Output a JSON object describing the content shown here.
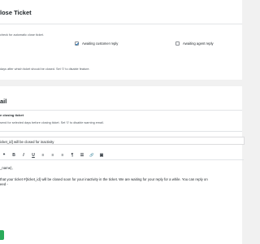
{
  "auto_close": {
    "title": "lose Ticket",
    "desc1": "check for automatic close ticket.",
    "options": [
      {
        "label": "Awaiting customer reply",
        "checked": true
      },
      {
        "label": "Awaiting agent reply",
        "checked": false
      }
    ],
    "desc2": "days after which ticket should be closed. Set '0' to disable feature."
  },
  "warning_email": {
    "title": "ail",
    "label": "e closing ticket",
    "desc": "send for selected days before closing ticket. Set '0' to disable warning email.",
    "subject_value": "icket_id] will be closed for inactivity",
    "toolbar": [
      {
        "name": "quote-icon",
        "glyph": "❝"
      },
      {
        "name": "bold-icon",
        "glyph": "B"
      },
      {
        "name": "italic-icon",
        "glyph": "I"
      },
      {
        "name": "underline-icon",
        "glyph": "U"
      },
      {
        "name": "align-left-icon",
        "glyph": "≡"
      },
      {
        "name": "align-center-icon",
        "glyph": "≡"
      },
      {
        "name": "align-right-icon",
        "glyph": "≡"
      },
      {
        "name": "paragraph-icon",
        "glyph": "¶"
      },
      {
        "name": "list-icon",
        "glyph": "☰"
      },
      {
        "name": "link-icon",
        "glyph": "🔗"
      },
      {
        "name": "image-icon",
        "glyph": "▣"
      }
    ],
    "body_line1": "_name},",
    "body_line2": " that your ticket #{ticket_id} will be closed soon for your inactivity in the ticket. We are waiting for your reply for a while. You can reply on",
    "body_line3": "eed -"
  },
  "colors": {
    "accent": "#2271b1",
    "save": "#2aab5a"
  }
}
